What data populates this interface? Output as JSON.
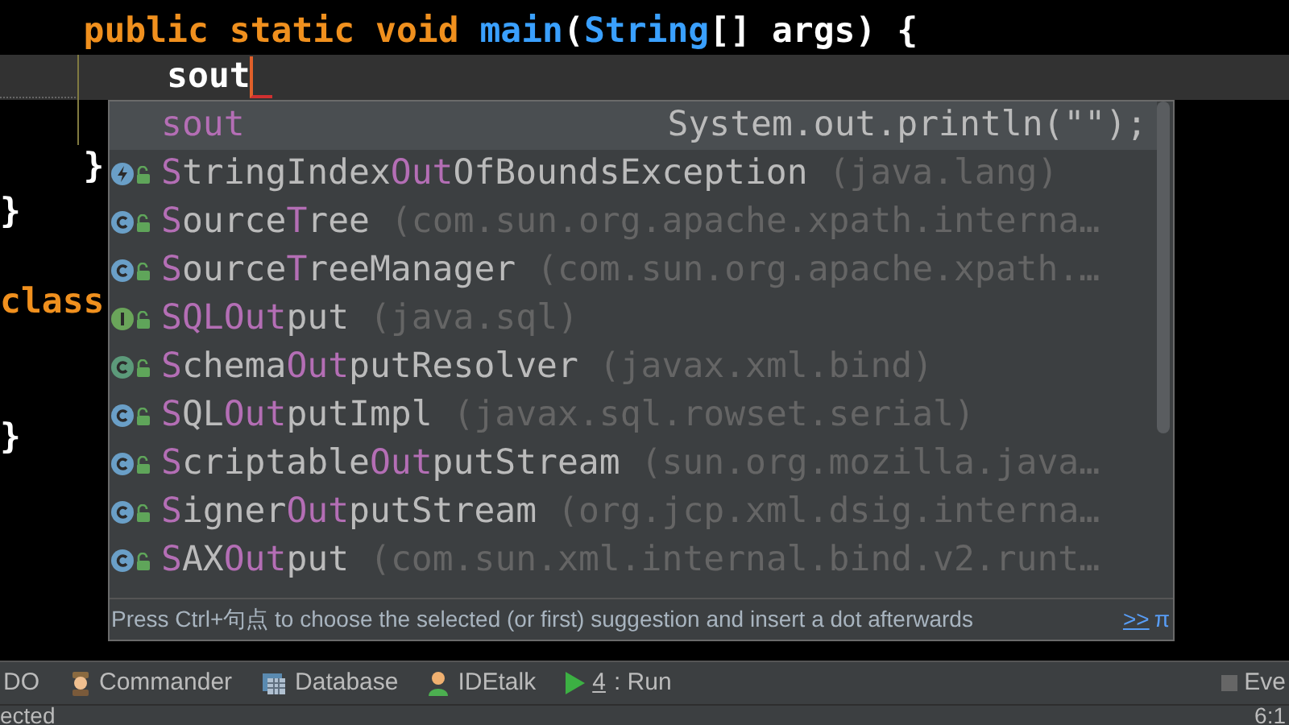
{
  "editor": {
    "lines": [
      {
        "current": false,
        "tokens": [
          {
            "text": "    public static void ",
            "kind": "keyword"
          },
          {
            "text": "main",
            "kind": "method"
          },
          {
            "text": "(",
            "kind": "plain"
          },
          {
            "text": "String",
            "kind": "type"
          },
          {
            "text": "[] args) {",
            "kind": "plain"
          }
        ]
      },
      {
        "current": true,
        "tokens": [
          {
            "text": "        sout",
            "kind": "plain"
          }
        ]
      },
      {
        "current": false
      },
      {
        "current": false,
        "tokens": [
          {
            "text": "    }",
            "kind": "plain"
          }
        ]
      },
      {
        "current": false,
        "tokens": [
          {
            "text": "}",
            "kind": "plain"
          }
        ]
      },
      {
        "current": false
      },
      {
        "current": false,
        "tokens": [
          {
            "text": "class",
            "kind": "keyword"
          }
        ]
      },
      {
        "current": false
      },
      {
        "current": false
      },
      {
        "current": false,
        "tokens": [
          {
            "text": "}",
            "kind": "plain"
          }
        ]
      }
    ]
  },
  "completion": {
    "items": [
      {
        "kind": "template",
        "selected": true,
        "segments": [
          {
            "text": "sout",
            "matched": true
          }
        ],
        "detail": "System.out.println(\"\");"
      },
      {
        "kind": "exception",
        "selected": false,
        "segments": [
          {
            "text": "S",
            "matched": true
          },
          {
            "text": "tringIndex",
            "matched": false
          },
          {
            "text": "Out",
            "matched": true
          },
          {
            "text": "OfBoundsException",
            "matched": false
          }
        ],
        "package": "(java.lang)"
      },
      {
        "kind": "class",
        "selected": false,
        "segments": [
          {
            "text": "S",
            "matched": true
          },
          {
            "text": "ource",
            "matched": false
          },
          {
            "text": "T",
            "matched": true
          },
          {
            "text": "ree",
            "matched": false
          }
        ],
        "package": "(com.sun.org.apache.xpath.interna…"
      },
      {
        "kind": "class",
        "selected": false,
        "segments": [
          {
            "text": "S",
            "matched": true
          },
          {
            "text": "ource",
            "matched": false
          },
          {
            "text": "T",
            "matched": true
          },
          {
            "text": "reeManager",
            "matched": false
          }
        ],
        "package": "(com.sun.org.apache.xpath.…"
      },
      {
        "kind": "interface",
        "selected": false,
        "segments": [
          {
            "text": "SQL",
            "matched": true
          },
          {
            "text": "Out",
            "matched": true
          },
          {
            "text": "put",
            "matched": false
          }
        ],
        "package": "(java.sql)"
      },
      {
        "kind": "abstract",
        "selected": false,
        "segments": [
          {
            "text": "S",
            "matched": true
          },
          {
            "text": "chema",
            "matched": false
          },
          {
            "text": "Out",
            "matched": true
          },
          {
            "text": "putResolver",
            "matched": false
          }
        ],
        "package": "(javax.xml.bind)"
      },
      {
        "kind": "class",
        "selected": false,
        "segments": [
          {
            "text": "S",
            "matched": true
          },
          {
            "text": "QL",
            "matched": false
          },
          {
            "text": "Out",
            "matched": true
          },
          {
            "text": "putImpl",
            "matched": false
          }
        ],
        "package": "(javax.sql.rowset.serial)"
      },
      {
        "kind": "class",
        "selected": false,
        "segments": [
          {
            "text": "S",
            "matched": true
          },
          {
            "text": "criptable",
            "matched": false
          },
          {
            "text": "Out",
            "matched": true
          },
          {
            "text": "putStream",
            "matched": false
          }
        ],
        "package": "(sun.org.mozilla.java…"
      },
      {
        "kind": "class",
        "selected": false,
        "segments": [
          {
            "text": "S",
            "matched": true
          },
          {
            "text": "igner",
            "matched": false
          },
          {
            "text": "Out",
            "matched": true
          },
          {
            "text": "putStream",
            "matched": false
          }
        ],
        "package": "(org.jcp.xml.dsig.interna…"
      },
      {
        "kind": "class",
        "selected": false,
        "segments": [
          {
            "text": "S",
            "matched": true
          },
          {
            "text": "AX",
            "matched": false
          },
          {
            "text": "Out",
            "matched": true
          },
          {
            "text": "put",
            "matched": false
          }
        ],
        "package": "(com.sun.xml.internal.bind.v2.runt…"
      }
    ],
    "hint": "Press Ctrl+句点 to choose the selected (or first) suggestion and insert a dot afterwards",
    "hint_link": ">>",
    "hint_symbol": "π"
  },
  "tool_bar": [
    {
      "kind": "plain",
      "label": "DO"
    },
    {
      "kind": "commander",
      "label": "Commander"
    },
    {
      "kind": "database",
      "label": "Database"
    },
    {
      "kind": "idetalk",
      "label": "IDEtalk"
    },
    {
      "kind": "run",
      "mnemonic": "4",
      "label": ": Run"
    }
  ],
  "tool_bar_right": "Eve",
  "status_bar": {
    "left": "ected",
    "right": "6:1"
  }
}
